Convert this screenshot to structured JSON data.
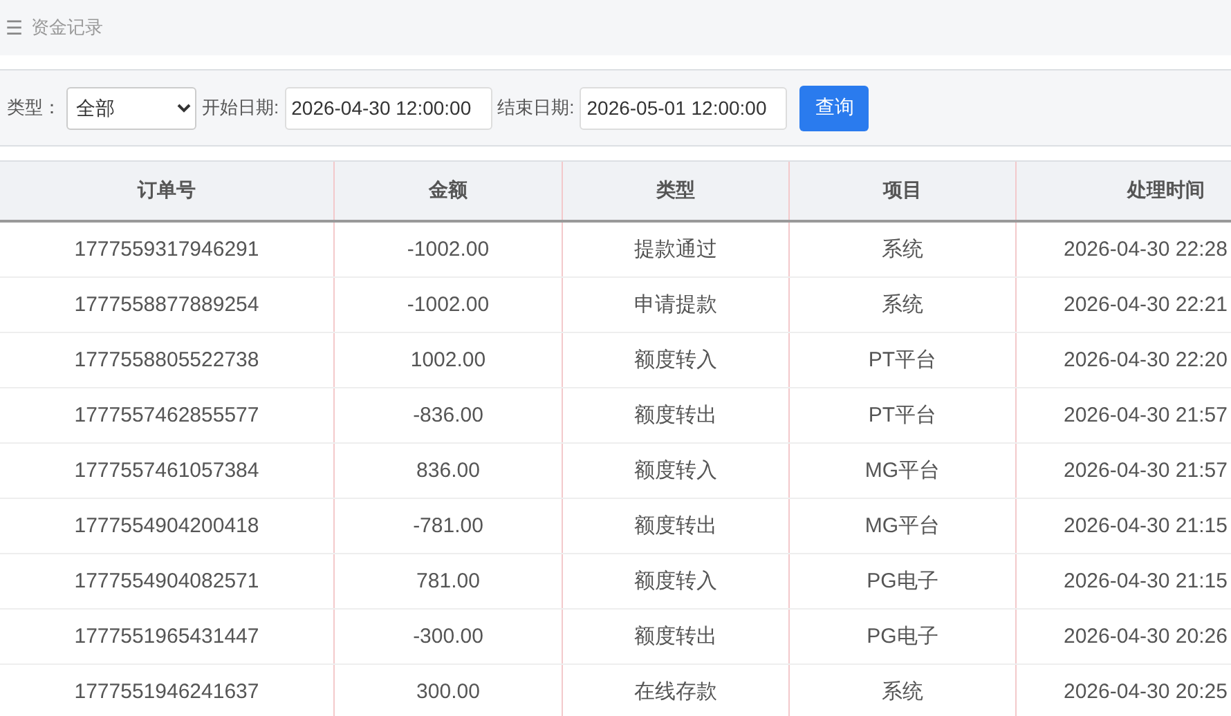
{
  "header": {
    "menu_icon": "☰",
    "title": "资金记录"
  },
  "filters": {
    "type_label": "类型：",
    "type_value": "全部",
    "start_label": "开始日期:",
    "start_value": "2026-04-30 12:00:00",
    "end_label": "结束日期:",
    "end_value": "2026-05-01 12:00:00",
    "query_button": "查询"
  },
  "table": {
    "columns": [
      "订单号",
      "金额",
      "类型",
      "项目",
      "处理时间"
    ],
    "rows": [
      [
        "1777559317946291",
        "-1002.00",
        "提款通过",
        "系统",
        "2026-04-30 22:28"
      ],
      [
        "1777558877889254",
        "-1002.00",
        "申请提款",
        "系统",
        "2026-04-30 22:21"
      ],
      [
        "1777558805522738",
        "1002.00",
        "额度转入",
        "PT平台",
        "2026-04-30 22:20"
      ],
      [
        "1777557462855577",
        "-836.00",
        "额度转出",
        "PT平台",
        "2026-04-30 21:57"
      ],
      [
        "1777557461057384",
        "836.00",
        "额度转入",
        "MG平台",
        "2026-04-30 21:57"
      ],
      [
        "1777554904200418",
        "-781.00",
        "额度转出",
        "MG平台",
        "2026-04-30 21:15"
      ],
      [
        "1777554904082571",
        "781.00",
        "额度转入",
        "PG电子",
        "2026-04-30 21:15"
      ],
      [
        "1777551965431447",
        "-300.00",
        "额度转出",
        "PG电子",
        "2026-04-30 20:26"
      ],
      [
        "1777551946241637",
        "300.00",
        "在线存款",
        "系统",
        "2026-04-30 20:25"
      ]
    ]
  }
}
